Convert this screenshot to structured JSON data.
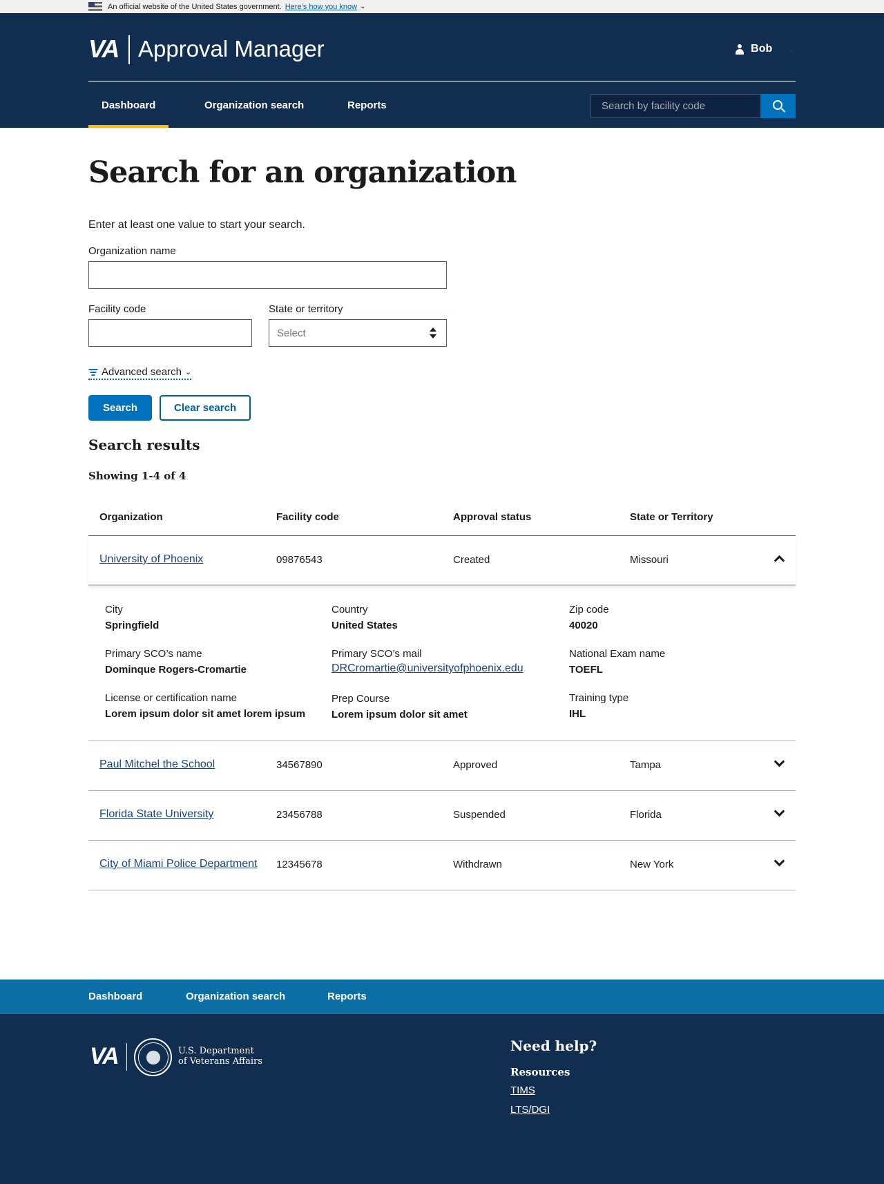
{
  "gov_banner": {
    "text": "An official website of the United States government.",
    "link": "Here’s how you know"
  },
  "header": {
    "logo": "VA",
    "app_name": "Approval Manager",
    "user": "Bob",
    "nav": [
      "Dashboard",
      "Organization search",
      "Reports"
    ],
    "active_nav": "Dashboard",
    "search_placeholder": "Search by facility code"
  },
  "main": {
    "title": "Search for an organization",
    "intro": "Enter at least one value to start your search.",
    "org_name_label": "Organization name",
    "facility_code_label": "Facility code",
    "state_label": "State or territory",
    "state_value": "Select",
    "advanced_search": "Advanced search",
    "search_button": "Search",
    "clear_button": "Clear search",
    "results_heading": "Search results",
    "showing": "Showing 1-4 of 4"
  },
  "table": {
    "headers": [
      "Organization",
      "Facility code",
      "Approval status",
      "State or Territory"
    ],
    "rows": [
      {
        "org": "University of Phoenix",
        "code": "09876543",
        "status": "Created",
        "state": "Missouri",
        "expanded": true
      },
      {
        "org": "Paul Mitchel the School",
        "code": "34567890",
        "status": "Approved",
        "state": "Tampa",
        "expanded": false
      },
      {
        "org": "Florida State University",
        "code": "23456788",
        "status": "Suspended",
        "state": "Florida",
        "expanded": false
      },
      {
        "org": "City of Miami Police Department",
        "code": "12345678",
        "status": "Withdrawn",
        "state": "New York",
        "expanded": false
      }
    ],
    "details": {
      "city_label": "City",
      "city": "Springfield",
      "country_label": "Country",
      "country": "United States",
      "zip_label": "Zip code",
      "zip": "40020",
      "sco_name_label": "Primary SCO’s name",
      "sco_name": "Dominque Rogers-Cromartie",
      "sco_mail_label": "Primary SCO’s mail",
      "sco_mail": "DRCromartie@universityofphoenix.edu",
      "exam_label": "National Exam name",
      "exam": "TOEFL",
      "license_label": "License or certification name",
      "license": "Lorem ipsum dolor sit amet lorem ipsum",
      "prep_label": "Prep Course",
      "prep": "Lorem ipsum dolor sit amet",
      "training_label": "Training type",
      "training": "IHL"
    }
  },
  "footer": {
    "nav": [
      "Dashboard",
      "Organization search",
      "Reports"
    ],
    "logo": "VA",
    "dept_line1": "U.S. Department",
    "dept_line2": "of Veterans Affairs",
    "need_help": "Need help?",
    "resources": "Resources",
    "links": [
      "TIMS",
      "LTS/DGI"
    ]
  }
}
